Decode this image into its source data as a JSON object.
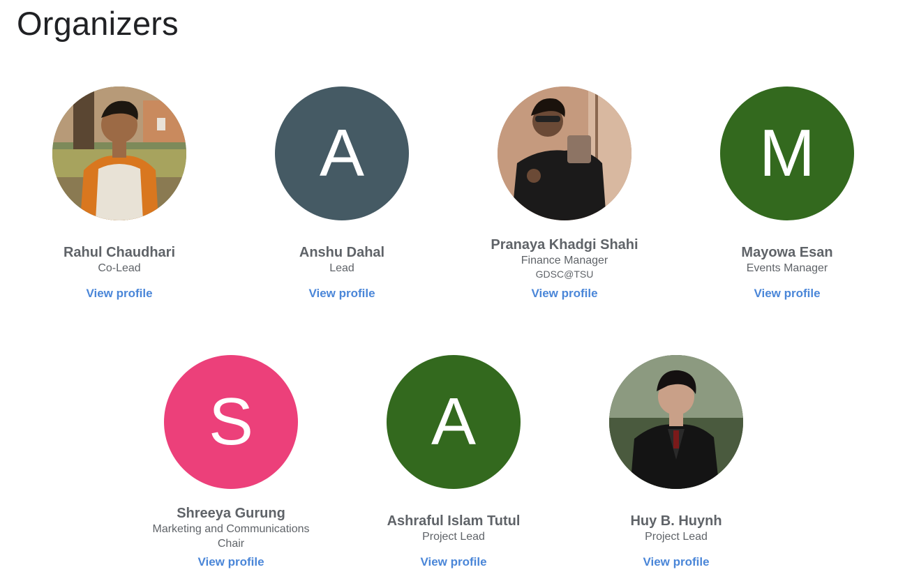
{
  "page": {
    "title": "Organizers"
  },
  "colors": {
    "slate": "#455a64",
    "green": "#33691e",
    "pink": "#ec407a",
    "link": "#4a86d8"
  },
  "organizers": [
    {
      "name": "Rahul Chaudhari",
      "role": "Co-Lead",
      "extra": "",
      "avatar": "photo",
      "link": "View profile"
    },
    {
      "name": "Anshu Dahal",
      "role": "Lead",
      "extra": "",
      "avatar": "A",
      "link": "View profile"
    },
    {
      "name": "Pranaya Khadgi Shahi",
      "role": "Finance Manager",
      "extra": "GDSC@TSU",
      "avatar": "photo",
      "link": "View profile"
    },
    {
      "name": "Mayowa Esan",
      "role": "Events Manager",
      "extra": "",
      "avatar": "M",
      "link": "View profile"
    },
    {
      "name": "Shreeya Gurung",
      "role": "Marketing and Communications",
      "role2": "Chair",
      "extra": "",
      "avatar": "S",
      "link": "View profile"
    },
    {
      "name": "Ashraful Islam Tutul",
      "role": "Project Lead",
      "extra": "",
      "avatar": "A",
      "link": "View profile"
    },
    {
      "name": "Huy B. Huynh",
      "role": "Project Lead",
      "extra": "",
      "avatar": "photo",
      "link": "View profile"
    }
  ]
}
